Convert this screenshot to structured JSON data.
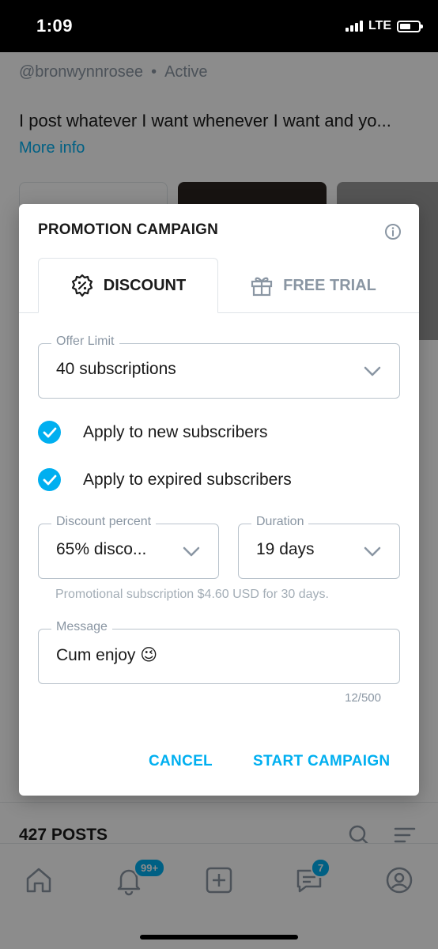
{
  "status_bar": {
    "time": "1:09",
    "network": "LTE"
  },
  "profile": {
    "handle": "@bronwynnrosee",
    "separator": "•",
    "status": "Active",
    "bio": "I post whatever I want whenever I want and yo...",
    "more_info": "More info",
    "posts_count": "427 POSTS"
  },
  "nav": {
    "notifications_badge": "99+",
    "messages_badge": "7"
  },
  "dialog": {
    "title": "PROMOTION CAMPAIGN",
    "tabs": [
      {
        "label": "DISCOUNT",
        "icon": "discount-badge-icon",
        "active": true
      },
      {
        "label": "FREE TRIAL",
        "icon": "gift-icon",
        "active": false
      }
    ],
    "offer_limit": {
      "label": "Offer Limit",
      "value": "40 subscriptions"
    },
    "checkboxes": [
      {
        "label": "Apply to new subscribers",
        "checked": true
      },
      {
        "label": "Apply to expired subscribers",
        "checked": true
      }
    ],
    "discount_percent": {
      "label": "Discount percent",
      "value": "65% disco..."
    },
    "duration": {
      "label": "Duration",
      "value": "19 days"
    },
    "helper_text": "Promotional subscription $4.60 USD for 30 days.",
    "message": {
      "label": "Message",
      "value": "Cum enjoy 😉"
    },
    "counter": "12/500",
    "cancel_label": "CANCEL",
    "start_label": "START CAMPAIGN"
  },
  "colors": {
    "accent": "#00aff0",
    "muted": "#8a96a3",
    "border": "#b9c3cc"
  }
}
